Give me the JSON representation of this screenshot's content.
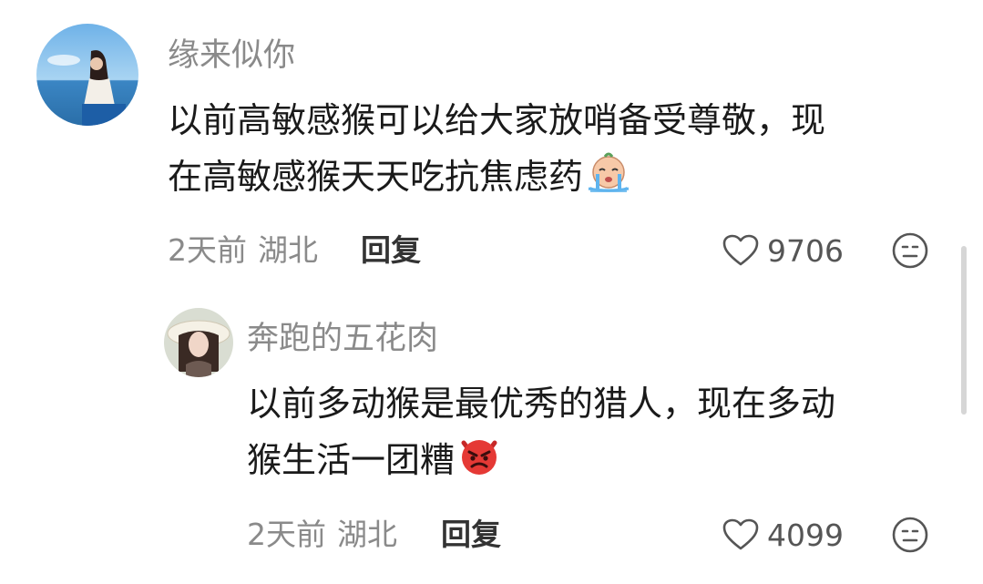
{
  "comments": [
    {
      "username": "缘来似你",
      "content_lines": [
        "以前高敏感猴可以给大家放哨备受尊敬，现",
        "在高敏感猴天天吃抗焦虑药"
      ],
      "content_emoji": "crying-face-emoji",
      "time": "2天前",
      "location": "湖北",
      "reply_label": "回复",
      "likes": "9706",
      "avatar": "woman-by-sea-avatar"
    },
    {
      "username": "奔跑的五花肉",
      "content_lines": [
        "以前多动猴是最优秀的猎人，现在多动",
        "猴生活一团糟"
      ],
      "content_emoji": "angry-devil-emoji",
      "time": "2天前",
      "location": "湖北",
      "reply_label": "回复",
      "likes": "4099",
      "avatar": "woman-with-hat-avatar"
    }
  ],
  "colors": {
    "username": "#8a8a8a",
    "text": "#1a1a1a",
    "meta": "#8a8a8a",
    "reply": "#333333"
  }
}
